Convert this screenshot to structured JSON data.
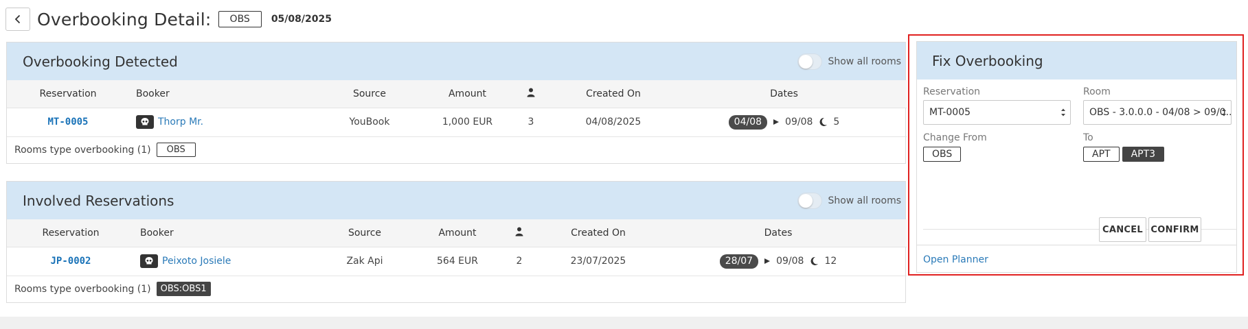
{
  "header": {
    "title": "Overbooking Detail:",
    "badge": "OBS",
    "date": "05/08/2025"
  },
  "overbooking": {
    "title": "Overbooking Detected",
    "toggle_label": "Show all rooms",
    "columns": [
      "Reservation",
      "Booker",
      "Source",
      "Amount",
      "guests-icon",
      "Created On",
      "Dates"
    ],
    "row": {
      "reservation": "MT-0005",
      "booker": "Thorp Mr.",
      "source": "YouBook",
      "amount": "1,000 EUR",
      "guests": "3",
      "created_on": "04/08/2025",
      "date_from": "04/08",
      "date_to": "09/08",
      "nights": "5"
    },
    "footer_label": "Rooms type overbooking (1)",
    "footer_tag": "OBS"
  },
  "involved": {
    "title": "Involved Reservations",
    "toggle_label": "Show all rooms",
    "row": {
      "reservation": "JP-0002",
      "booker": "Peixoto Josiele",
      "source": "Zak Api",
      "amount": "564 EUR",
      "guests": "2",
      "created_on": "23/07/2025",
      "date_from": "28/07",
      "date_to": "09/08",
      "nights": "12"
    },
    "footer_label": "Rooms type overbooking (1)",
    "footer_tag": "OBS:OBS1"
  },
  "columns": {
    "reservation": "Reservation",
    "booker": "Booker",
    "source": "Source",
    "amount": "Amount",
    "created_on": "Created On",
    "dates": "Dates"
  },
  "fix": {
    "title": "Fix Overbooking",
    "reservation_label": "Reservation",
    "reservation_value": "MT-0005",
    "room_label": "Room",
    "room_value": "OBS - 3.0.0.0 - 04/08 > 09/0...",
    "change_from_label": "Change From",
    "change_from_value": "OBS",
    "to_label": "To",
    "to_options": [
      "APT",
      "APT3"
    ],
    "to_selected": "APT3",
    "cancel_label": "CANCEL",
    "confirm_label": "CONFIRM",
    "open_planner_label": "Open Planner"
  }
}
